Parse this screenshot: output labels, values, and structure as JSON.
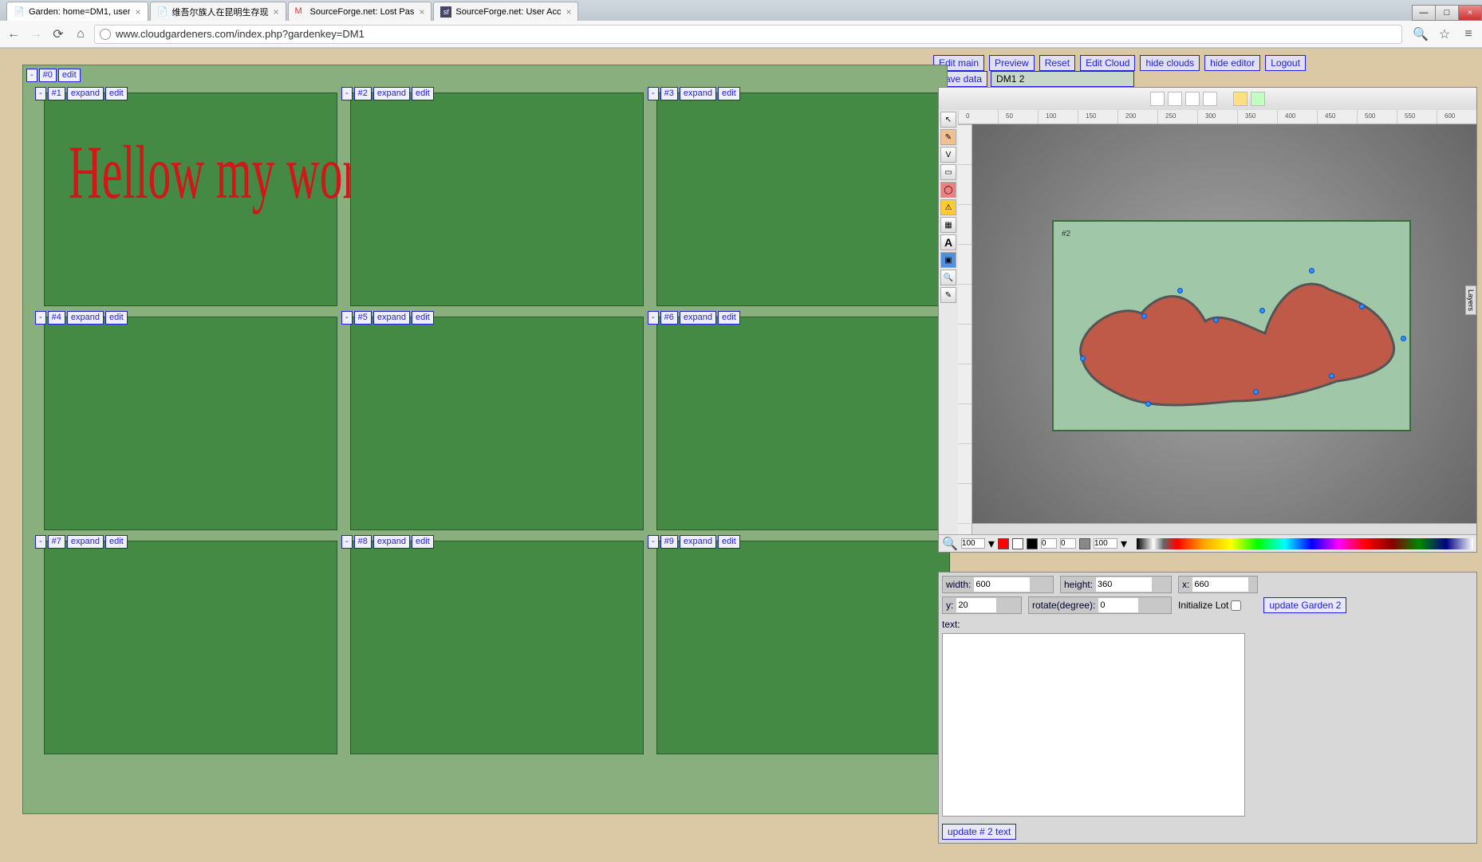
{
  "browser": {
    "tabs": [
      {
        "title": "Garden: home=DM1, user"
      },
      {
        "title": "维吾尔族人在昆明生存现"
      },
      {
        "title": "SourceForge.net: Lost Pas"
      },
      {
        "title": "SourceForge.net: User Acc"
      }
    ],
    "url": "www.cloudgardeners.com/index.php?gardenkey=DM1"
  },
  "editor_buttons": {
    "edit_main": "Edit main",
    "preview": "Preview",
    "reset": "Reset",
    "edit_cloud": "Edit Cloud",
    "hide_clouds": "hide clouds",
    "hide_editor": "hide editor",
    "logout": "Logout",
    "save_data": "Save data",
    "dm_label": "DM1 2"
  },
  "garden": {
    "top": {
      "minus": "-",
      "id": "#0",
      "edit": "edit"
    },
    "cells": [
      {
        "id": "#1",
        "minus": "-",
        "expand": "expand",
        "edit": "edit",
        "text": "Hellow my world"
      },
      {
        "id": "#2",
        "minus": "-",
        "expand": "expand",
        "edit": "edit"
      },
      {
        "id": "#3",
        "minus": "-",
        "expand": "expand",
        "edit": "edit"
      },
      {
        "id": "#4",
        "minus": "-",
        "expand": "expand",
        "edit": "edit"
      },
      {
        "id": "#5",
        "minus": "-",
        "expand": "expand",
        "edit": "edit"
      },
      {
        "id": "#6",
        "minus": "-",
        "expand": "expand",
        "edit": "edit"
      },
      {
        "id": "#7",
        "minus": "-",
        "expand": "expand",
        "edit": "edit"
      },
      {
        "id": "#8",
        "minus": "-",
        "expand": "expand",
        "edit": "edit"
      },
      {
        "id": "#9",
        "minus": "-",
        "expand": "expand",
        "edit": "edit"
      }
    ]
  },
  "svg_editor": {
    "ruler_marks": [
      "0",
      "50",
      "100",
      "150",
      "200",
      "250",
      "300",
      "350",
      "400",
      "450",
      "500",
      "550",
      "600"
    ],
    "canvas_label": "#2",
    "layers": "Layers",
    "zoom": "100",
    "opacity": "100",
    "stroke_opacity": "0",
    "stroke_width": "0"
  },
  "props": {
    "width_label": "width:",
    "width": "600",
    "height_label": "height:",
    "height": "360",
    "x_label": "x:",
    "x": "660",
    "y_label": "y:",
    "y": "20",
    "rotate_label": "rotate(degree):",
    "rotate": "0",
    "init_lot": "Initialize Lot",
    "update_garden": "update Garden 2",
    "text_label": "text:",
    "update_text": "update # 2 text"
  }
}
